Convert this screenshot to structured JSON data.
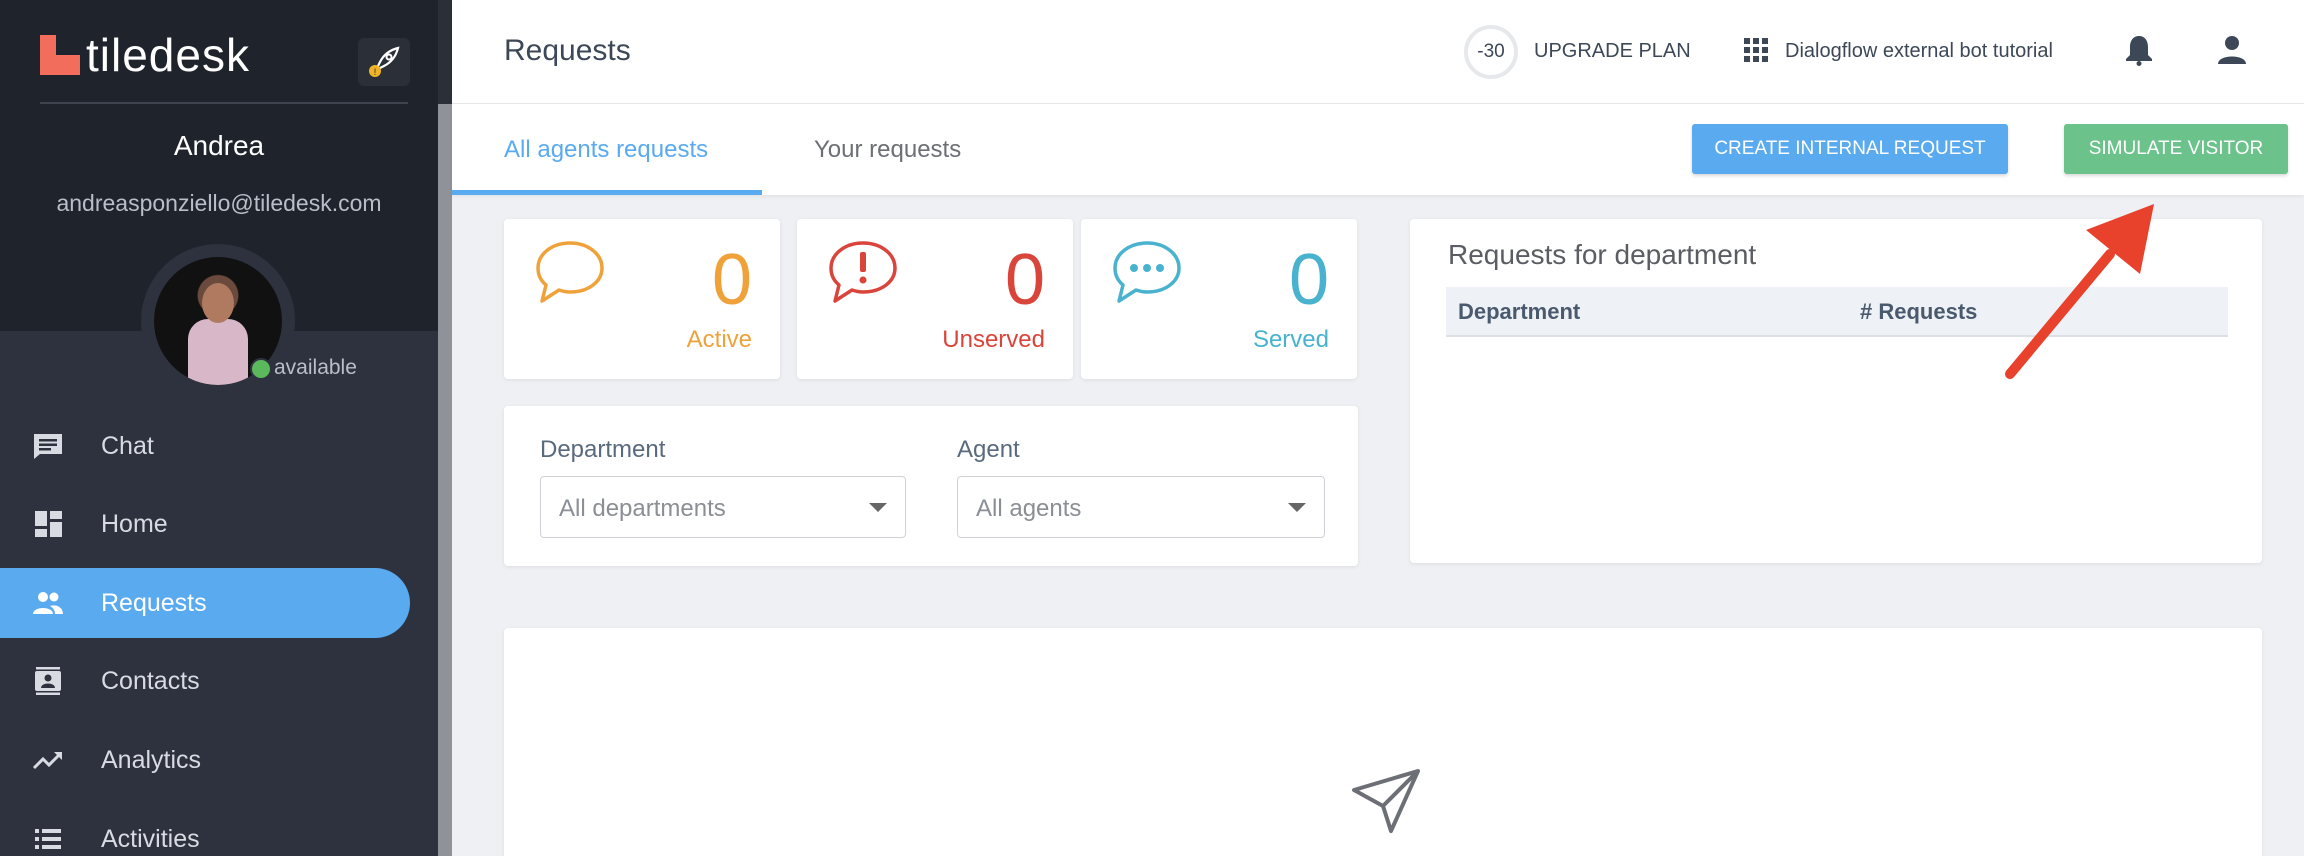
{
  "sidebar": {
    "logo_text": "tiledesk",
    "user_name": "Andrea",
    "user_email": "andreasponziello@tiledesk.com",
    "user_status": "available",
    "items": [
      {
        "label": "Chat",
        "icon": "chat-icon"
      },
      {
        "label": "Home",
        "icon": "dashboard-icon"
      },
      {
        "label": "Requests",
        "icon": "people-icon",
        "active": true
      },
      {
        "label": "Contacts",
        "icon": "contacts-icon"
      },
      {
        "label": "Analytics",
        "icon": "trending-icon"
      },
      {
        "label": "Activities",
        "icon": "list-icon"
      }
    ]
  },
  "header": {
    "title": "Requests",
    "trial_days": "-30",
    "upgrade_label": "UPGRADE PLAN",
    "project_name": "Dialogflow external bot tutorial"
  },
  "tabs": {
    "all_agents": "All agents requests",
    "yours": "Your requests"
  },
  "actions": {
    "create_internal": "CREATE INTERNAL REQUEST",
    "simulate_visitor": "SIMULATE VISITOR"
  },
  "stats": [
    {
      "value": "0",
      "label": "Active",
      "color": "#f0a23a",
      "icon": "chat-bubble-icon"
    },
    {
      "value": "0",
      "label": "Unserved",
      "color": "#d9453b",
      "icon": "alert-bubble-icon"
    },
    {
      "value": "0",
      "label": "Served",
      "color": "#48b2cf",
      "icon": "dots-bubble-icon"
    }
  ],
  "filters": {
    "department_label": "Department",
    "department_value": "All departments",
    "agent_label": "Agent",
    "agent_value": "All agents"
  },
  "department_table": {
    "title": "Requests for department",
    "col_department": "Department",
    "col_requests": "# Requests"
  },
  "colors": {
    "accent": "#5aaaf0",
    "success": "#6bc28b",
    "sidebar_bg": "#2d323e",
    "annotation_arrow": "#e8412c"
  }
}
